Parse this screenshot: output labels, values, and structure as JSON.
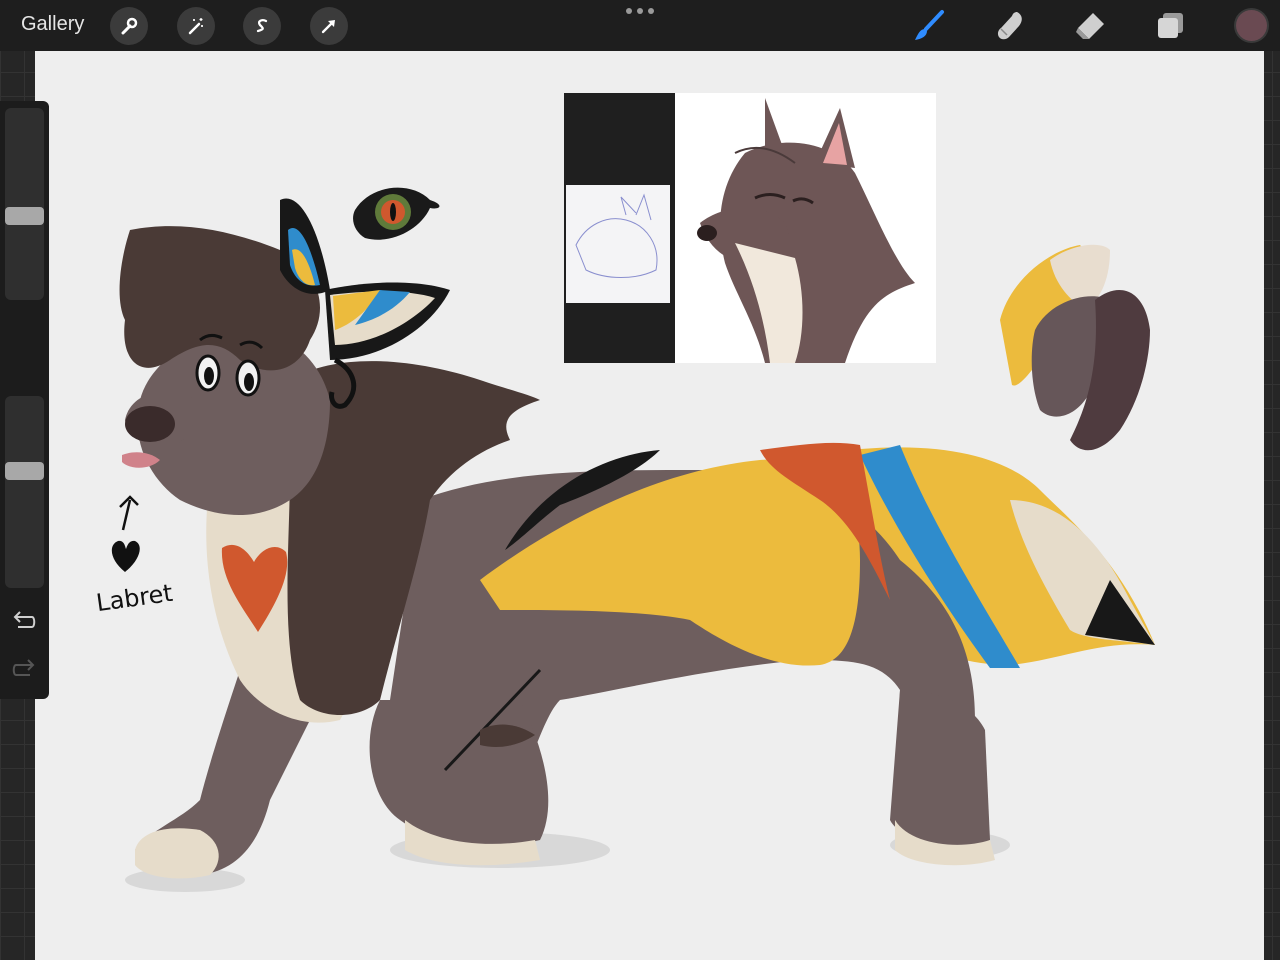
{
  "toolbar": {
    "gallery_label": "Gallery",
    "actions": [
      {
        "name": "actions",
        "icon": "wrench-icon"
      },
      {
        "name": "adjustments",
        "icon": "magic-wand-icon"
      },
      {
        "name": "selection",
        "icon": "selection-s-icon"
      },
      {
        "name": "transform",
        "icon": "arrow-cursor-icon"
      }
    ],
    "more_icon": "ellipsis-icon",
    "right_tools": [
      {
        "name": "brush",
        "icon": "paintbrush-icon",
        "active": true
      },
      {
        "name": "smudge",
        "icon": "smudge-finger-icon",
        "active": false
      },
      {
        "name": "eraser",
        "icon": "eraser-icon",
        "active": false
      },
      {
        "name": "layers",
        "icon": "layers-icon",
        "active": false
      }
    ],
    "current_color": "#6a4a52",
    "accent_color": "#2f8cff"
  },
  "sidebar": {
    "brush_size_level": 0.55,
    "opacity_level": 0.55,
    "modify_icon": "square-icon",
    "undo_icon": "undo-icon",
    "redo_icon": "redo-icon"
  },
  "canvas": {
    "annotation_text": "Labret",
    "palette_colors": [
      "#ecbb3d",
      "#e8ddcf",
      "#665659",
      "#4f3b3f"
    ],
    "character_colors": {
      "fur_dark": "#4a3a36",
      "fur_mid": "#6e5e5e",
      "cream": "#e6dcca",
      "yellow": "#ecbb3d",
      "orange": "#d0582e",
      "blue": "#2f8ccc",
      "black": "#181818"
    }
  }
}
